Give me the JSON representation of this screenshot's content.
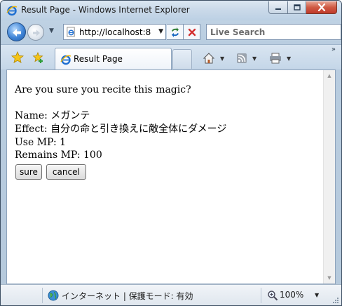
{
  "window": {
    "title": "Result Page - Windows Internet Explorer"
  },
  "address_bar": {
    "url": "http://localhost:8",
    "search_placeholder": "Live Search"
  },
  "tabs": [
    {
      "label": "Result Page",
      "active": true
    }
  ],
  "page": {
    "question": "Are you sure you recite this magic?",
    "name_label": "Name:",
    "name_value": "メガンテ",
    "effect_label": "Effect:",
    "effect_value": "自分の命と引き換えに敵全体にダメージ",
    "use_mp_label": "Use MP:",
    "use_mp_value": "1",
    "remains_mp_label": "Remains MP:",
    "remains_mp_value": "100",
    "sure_button": "sure",
    "cancel_button": "cancel"
  },
  "status_bar": {
    "zone": "インターネット | 保護モード: 有効",
    "zoom": "100%"
  },
  "colors": {
    "frame": "#b9cde0",
    "close_button": "#c0392b",
    "back_button": "#3f84d6"
  },
  "icons": {
    "title": "ie-logo-icon",
    "back": "back-arrow-icon",
    "forward": "forward-arrow-icon",
    "refresh": "refresh-icon",
    "stop": "stop-icon",
    "favorites": "favorites-star-icon",
    "add_favorites": "add-favorites-icon",
    "home": "home-icon",
    "feeds": "feeds-icon",
    "print": "print-icon",
    "zone": "globe-icon",
    "zoom": "zoom-icon"
  }
}
